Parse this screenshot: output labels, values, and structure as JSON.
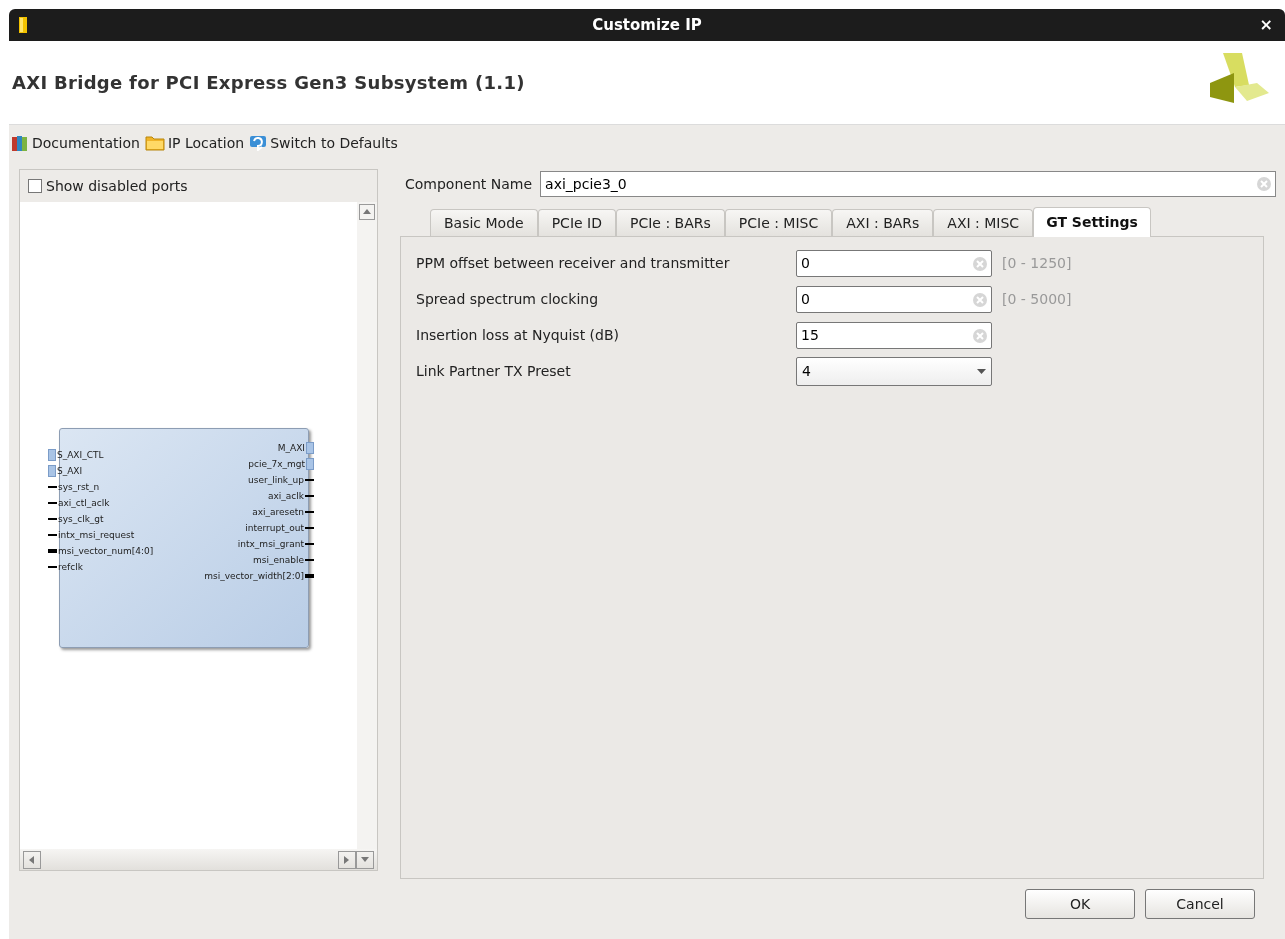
{
  "window": {
    "title": "Customize IP",
    "close": "×"
  },
  "header": {
    "title": "AXI Bridge for PCI Express Gen3 Subsystem (1.1)"
  },
  "toolbar": [
    {
      "kind": "books",
      "label": "Documentation"
    },
    {
      "kind": "folder",
      "label": "IP Location"
    },
    {
      "kind": "refresh",
      "label": "Switch to Defaults"
    }
  ],
  "symbol_panel": {
    "show_disabled_ports": {
      "label": "Show disabled ports",
      "checked": false
    },
    "left_ports": [
      {
        "name": "S_AXI_CTL",
        "kind": "bus"
      },
      {
        "name": "S_AXI",
        "kind": "bus"
      },
      {
        "name": "sys_rst_n",
        "kind": "wire"
      },
      {
        "name": "axi_ctl_aclk",
        "kind": "wire"
      },
      {
        "name": "sys_clk_gt",
        "kind": "wire"
      },
      {
        "name": "intx_msi_request",
        "kind": "wire"
      },
      {
        "name": "msi_vector_num[4:0]",
        "kind": "vector"
      },
      {
        "name": "refclk",
        "kind": "wire"
      }
    ],
    "right_ports": [
      {
        "name": "M_AXI",
        "kind": "bus"
      },
      {
        "name": "pcie_7x_mgt",
        "kind": "bus"
      },
      {
        "name": "user_link_up",
        "kind": "wire"
      },
      {
        "name": "axi_aclk",
        "kind": "wire"
      },
      {
        "name": "axi_aresetn",
        "kind": "wire"
      },
      {
        "name": "interrupt_out",
        "kind": "wire"
      },
      {
        "name": "intx_msi_grant",
        "kind": "wire"
      },
      {
        "name": "msi_enable",
        "kind": "wire"
      },
      {
        "name": "msi_vector_width[2:0]",
        "kind": "vector"
      }
    ]
  },
  "component_name": {
    "label": "Component Name",
    "value": "axi_pcie3_0"
  },
  "tabs": [
    {
      "label": "Basic Mode",
      "selected": false
    },
    {
      "label": "PCIe ID",
      "selected": false
    },
    {
      "label": "PCIe : BARs",
      "selected": false
    },
    {
      "label": "PCIe : MISC",
      "selected": false
    },
    {
      "label": "AXI : BARs",
      "selected": false
    },
    {
      "label": "AXI : MISC",
      "selected": false
    },
    {
      "label": "GT Settings",
      "selected": true
    }
  ],
  "fields": [
    {
      "kind": "text",
      "label": "PPM offset between receiver and transmitter",
      "value": "0",
      "range": "[0 - 1250]"
    },
    {
      "kind": "text",
      "label": "Spread spectrum clocking",
      "value": "0",
      "range": "[0 - 5000]"
    },
    {
      "kind": "text",
      "label": "Insertion loss at Nyquist (dB)",
      "value": "15"
    },
    {
      "kind": "dropdown",
      "label": "Link Partner TX Preset",
      "value": "4"
    }
  ],
  "buttons": [
    "OK",
    "Cancel"
  ]
}
